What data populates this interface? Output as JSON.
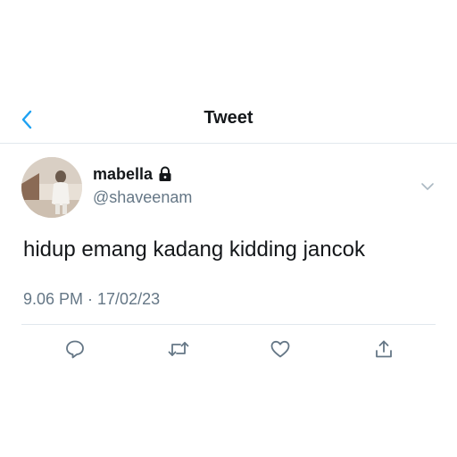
{
  "header": {
    "title": "Tweet",
    "back_icon": "chevron-left-icon",
    "accent_color": "#1da1f2"
  },
  "tweet": {
    "display_name": "mabella",
    "protected_icon": "lock-icon",
    "handle": "@shaveenam",
    "text": "hidup emang kadang kidding jancok",
    "timestamp": "9.06 PM · 17/02/23",
    "more_icon": "chevron-down-icon"
  },
  "actions": [
    {
      "name": "reply",
      "icon": "reply-icon"
    },
    {
      "name": "retweet",
      "icon": "retweet-icon"
    },
    {
      "name": "like",
      "icon": "heart-icon"
    },
    {
      "name": "share",
      "icon": "share-icon"
    }
  ],
  "colors": {
    "text_primary": "#14171a",
    "text_secondary": "#657786",
    "divider": "#e1e8ed",
    "icon": "#657786"
  }
}
